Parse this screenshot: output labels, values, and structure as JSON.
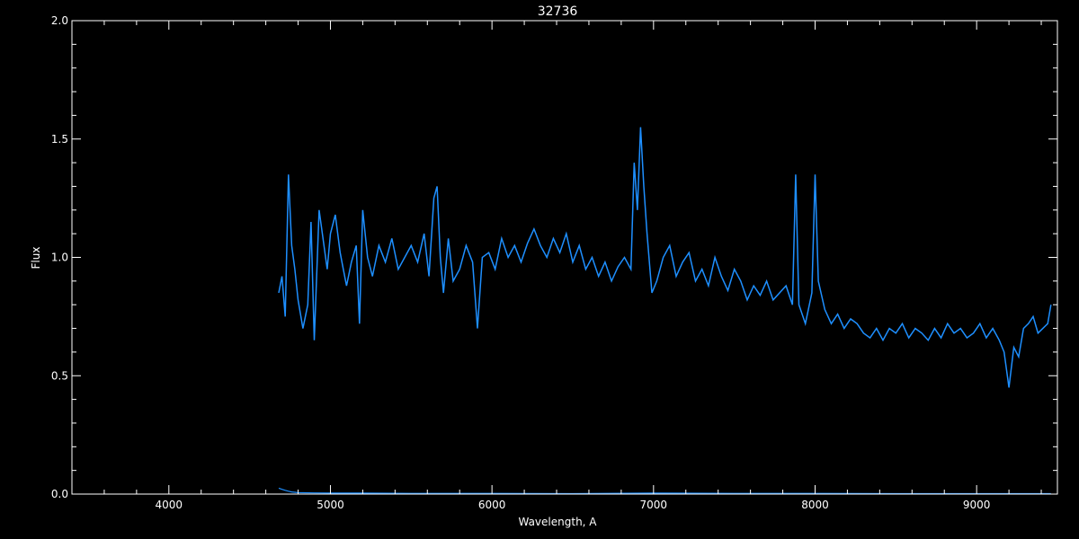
{
  "chart_data": {
    "type": "line",
    "title": "32736",
    "xlabel": "Wavelength, A",
    "ylabel": "Flux",
    "xlim": [
      3400,
      9500
    ],
    "ylim": [
      0.0,
      2.0
    ],
    "xticks": [
      {
        "value": 4000,
        "label": "4000"
      },
      {
        "value": 5000,
        "label": "5000"
      },
      {
        "value": 6000,
        "label": "6000"
      },
      {
        "value": 7000,
        "label": "7000"
      },
      {
        "value": 8000,
        "label": "8000"
      },
      {
        "value": 9000,
        "label": "9000"
      }
    ],
    "yticks": [
      {
        "value": 0.0,
        "label": "0.0"
      },
      {
        "value": 0.5,
        "label": "0.5"
      },
      {
        "value": 1.0,
        "label": "1.0"
      },
      {
        "value": 1.5,
        "label": "1.5"
      },
      {
        "value": 2.0,
        "label": "2.0"
      }
    ],
    "x_minor_step": 200,
    "y_minor_step": 0.1,
    "grid": false,
    "background_color": "#000000",
    "axis_color": "#ffffff",
    "series": [
      {
        "color": "#1e8fff",
        "x": [
          4680,
          4700,
          4720,
          4740,
          4760,
          4780,
          4800,
          4830,
          4860,
          4880,
          4900,
          4930,
          4960,
          4980,
          5000,
          5030,
          5060,
          5080,
          5100,
          5130,
          5160,
          5180,
          5200,
          5230,
          5260,
          5300,
          5340,
          5380,
          5420,
          5460,
          5500,
          5540,
          5580,
          5610,
          5640,
          5660,
          5680,
          5700,
          5730,
          5760,
          5800,
          5840,
          5880,
          5910,
          5940,
          5980,
          6020,
          6060,
          6100,
          6140,
          6180,
          6220,
          6260,
          6300,
          6340,
          6380,
          6420,
          6460,
          6500,
          6540,
          6580,
          6620,
          6660,
          6700,
          6740,
          6780,
          6820,
          6860,
          6880,
          6900,
          6920,
          6940,
          6960,
          6990,
          7020,
          7060,
          7100,
          7140,
          7180,
          7220,
          7260,
          7300,
          7340,
          7380,
          7420,
          7460,
          7500,
          7540,
          7580,
          7620,
          7660,
          7700,
          7740,
          7780,
          7820,
          7860,
          7880,
          7900,
          7940,
          7980,
          8000,
          8020,
          8060,
          8100,
          8140,
          8180,
          8220,
          8260,
          8300,
          8340,
          8380,
          8420,
          8460,
          8500,
          8540,
          8580,
          8620,
          8660,
          8700,
          8740,
          8780,
          8820,
          8860,
          8900,
          8940,
          8980,
          9020,
          9060,
          9100,
          9140,
          9170,
          9200,
          9230,
          9260,
          9290,
          9320,
          9350,
          9380,
          9410,
          9440,
          9460
        ],
        "y": [
          0.85,
          0.92,
          0.75,
          1.35,
          1.05,
          0.95,
          0.82,
          0.7,
          0.8,
          1.15,
          0.65,
          1.2,
          1.05,
          0.95,
          1.1,
          1.18,
          1.02,
          0.95,
          0.88,
          0.98,
          1.05,
          0.72,
          1.2,
          1.0,
          0.92,
          1.05,
          0.98,
          1.08,
          0.95,
          1.0,
          1.05,
          0.98,
          1.1,
          0.92,
          1.25,
          1.3,
          1.0,
          0.85,
          1.08,
          0.9,
          0.95,
          1.05,
          0.98,
          0.7,
          1.0,
          1.02,
          0.95,
          1.08,
          1.0,
          1.05,
          0.98,
          1.06,
          1.12,
          1.05,
          1.0,
          1.08,
          1.02,
          1.1,
          0.98,
          1.05,
          0.95,
          1.0,
          0.92,
          0.98,
          0.9,
          0.96,
          1.0,
          0.95,
          1.4,
          1.2,
          1.55,
          1.3,
          1.1,
          0.85,
          0.9,
          1.0,
          1.05,
          0.92,
          0.98,
          1.02,
          0.9,
          0.95,
          0.88,
          1.0,
          0.92,
          0.86,
          0.95,
          0.9,
          0.82,
          0.88,
          0.84,
          0.9,
          0.82,
          0.85,
          0.88,
          0.8,
          1.35,
          0.8,
          0.72,
          0.85,
          1.35,
          0.9,
          0.78,
          0.72,
          0.76,
          0.7,
          0.74,
          0.72,
          0.68,
          0.66,
          0.7,
          0.65,
          0.7,
          0.68,
          0.72,
          0.66,
          0.7,
          0.68,
          0.65,
          0.7,
          0.66,
          0.72,
          0.68,
          0.7,
          0.66,
          0.68,
          0.72,
          0.66,
          0.7,
          0.65,
          0.6,
          0.45,
          0.62,
          0.58,
          0.7,
          0.72,
          0.75,
          0.68,
          0.7,
          0.72,
          0.8
        ]
      },
      {
        "color": "#1e8fff",
        "x": [
          4680,
          4700,
          4720,
          4740,
          4760,
          4800,
          4900,
          5000,
          5200,
          5500,
          6000,
          6500,
          7000,
          7500,
          8000,
          8500,
          9000,
          9460
        ],
        "y": [
          0.025,
          0.02,
          0.016,
          0.012,
          0.009,
          0.006,
          0.005,
          0.004,
          0.004,
          0.003,
          0.003,
          0.002,
          0.004,
          0.003,
          0.003,
          0.002,
          0.002,
          0.002
        ]
      }
    ]
  }
}
